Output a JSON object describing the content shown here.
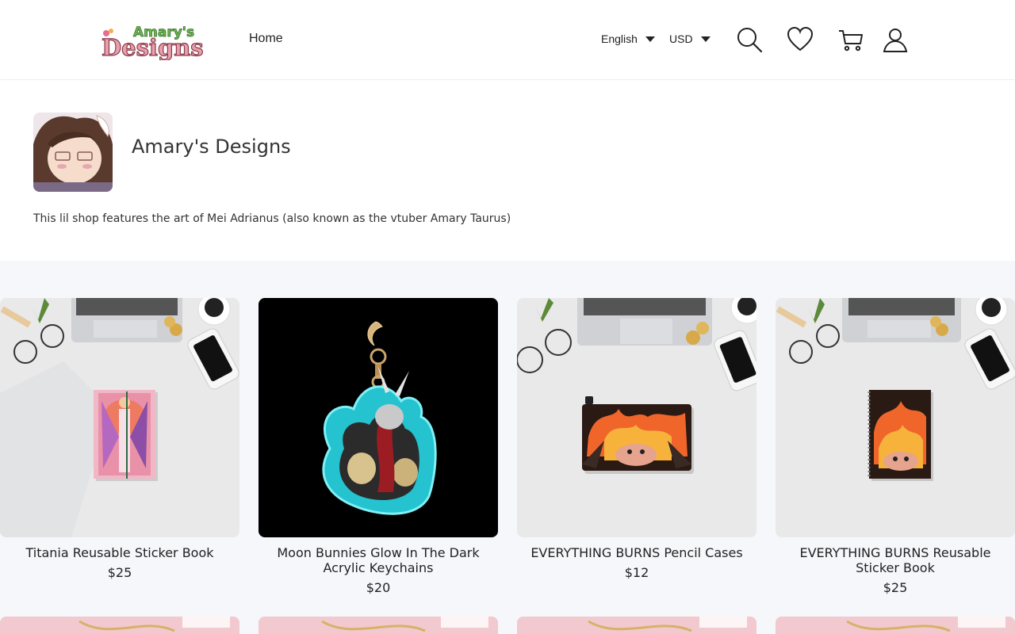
{
  "header": {
    "logo_alt": "Amary's Designs",
    "logo_line1": "Amary's",
    "logo_line2": "Designs",
    "nav_home": "Home",
    "language": "English",
    "currency": "USD",
    "icons": [
      "search-icon",
      "heart-icon",
      "cart-icon",
      "user-icon"
    ]
  },
  "shop": {
    "name": "Amary's Designs",
    "description": "This lil shop features the art of Mei Adrianus (also known as the vtuber Amary Taurus)"
  },
  "products": [
    {
      "title": "Titania Reusable Sticker Book",
      "price": "$25"
    },
    {
      "title": "Moon Bunnies Glow In The Dark Acrylic Keychains",
      "price": "$20"
    },
    {
      "title": "EVERYTHING BURNS Pencil Cases",
      "price": "$12"
    },
    {
      "title": "EVERYTHING BURNS Reusable Sticker Book",
      "price": "$25"
    }
  ],
  "colors": {
    "background": "#f5f7fa",
    "card": "#ffffff",
    "text": "#222222",
    "logo_green": "#5aa84a",
    "logo_pink": "#d9667a"
  }
}
